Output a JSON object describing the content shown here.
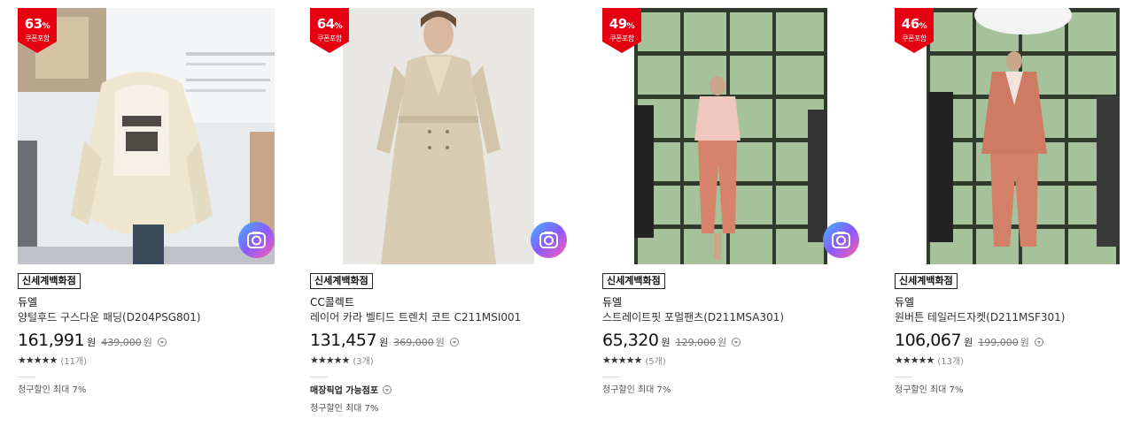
{
  "colors": {
    "badge_red": "#e60012",
    "camera_gradient": [
      "#3db5ff",
      "#8a5bff",
      "#ff5ca8"
    ]
  },
  "products": [
    {
      "discount_pct": "63",
      "pct_sign": "%",
      "coupon_label": "쿠폰포함",
      "store": "신세계백화점",
      "brand": "듀엘",
      "name": "양털후드 구스다운 패딩(D204PSG801)",
      "price": "161,991",
      "currency": "원",
      "original_price": "439,000",
      "original_currency": "원",
      "stars": "★★★★★",
      "rating": 5,
      "reviews": "(11개)",
      "pickup": "",
      "discount_note": "청구할인 최대 7%",
      "image_icon": "camera-search-icon"
    },
    {
      "discount_pct": "64",
      "pct_sign": "%",
      "coupon_label": "쿠폰포함",
      "store": "신세계백화점",
      "brand": "CC콜렉트",
      "name": "레이어 카라 벨티드 트렌치 코트 C211MSI001",
      "price": "131,457",
      "currency": "원",
      "original_price": "369,000",
      "original_currency": "원",
      "stars": "★★★★★",
      "rating": 5,
      "reviews": "(3개)",
      "pickup": "매장픽업 가능점포",
      "discount_note": "청구할인 최대 7%",
      "image_icon": "camera-search-icon"
    },
    {
      "discount_pct": "49",
      "pct_sign": "%",
      "coupon_label": "쿠폰포함",
      "store": "신세계백화점",
      "brand": "듀엘",
      "name": "스트레이트핏 포멀팬츠(D211MSA301)",
      "price": "65,320",
      "currency": "원",
      "original_price": "129,000",
      "original_currency": "원",
      "stars": "★★★★★",
      "rating": 5,
      "reviews": "(5개)",
      "pickup": "",
      "discount_note": "청구할인 최대 7%",
      "image_icon": "camera-search-icon"
    },
    {
      "discount_pct": "46",
      "pct_sign": "%",
      "coupon_label": "쿠폰포함",
      "store": "신세계백화점",
      "brand": "듀엘",
      "name": "원버튼 테일러드자켓(D211MSF301)",
      "price": "106,067",
      "currency": "원",
      "original_price": "199,000",
      "original_currency": "원",
      "stars": "★★★★★",
      "rating": 4.5,
      "reviews": "(13개)",
      "pickup": "",
      "discount_note": "청구할인 최대 7%",
      "image_icon": ""
    }
  ]
}
